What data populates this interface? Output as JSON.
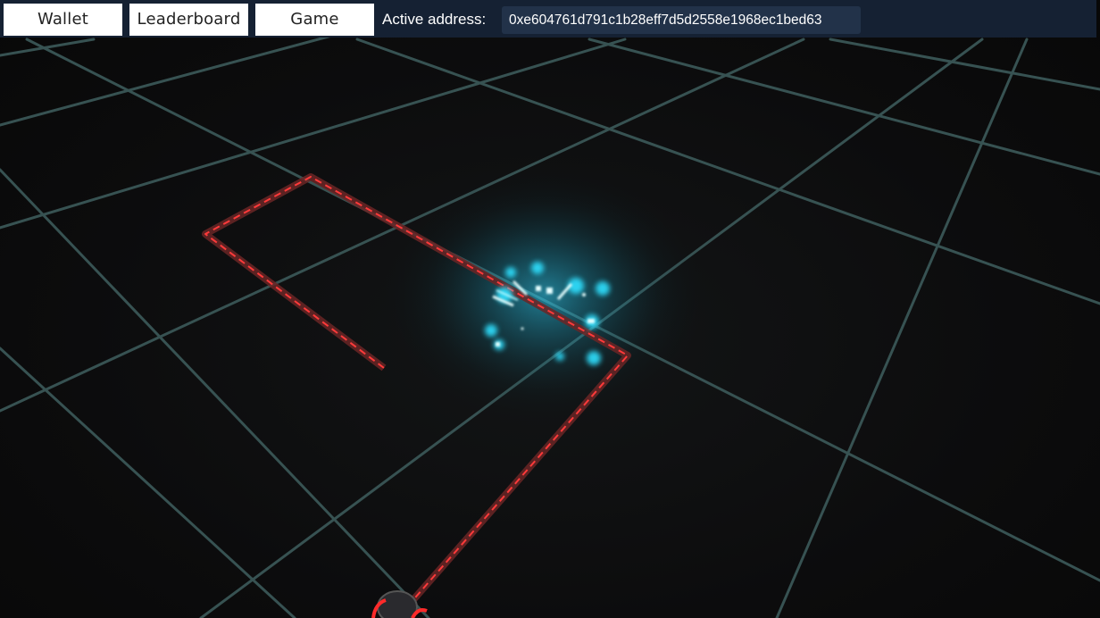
{
  "nav": {
    "wallet_label": "Wallet",
    "leaderboard_label": "Leaderboard",
    "game_label": "Game"
  },
  "address": {
    "label": "Active address:",
    "value": "0xe604761d791c1b28eff7d5d2558e1968ec1bed63"
  },
  "scene": {
    "grid_color": "#3c5a5a",
    "trail_color": "#ff3030",
    "trail_glow_color": "#7a2a2a",
    "particle_color": "#3fe6ff",
    "background_color": "#0b0b0c"
  }
}
